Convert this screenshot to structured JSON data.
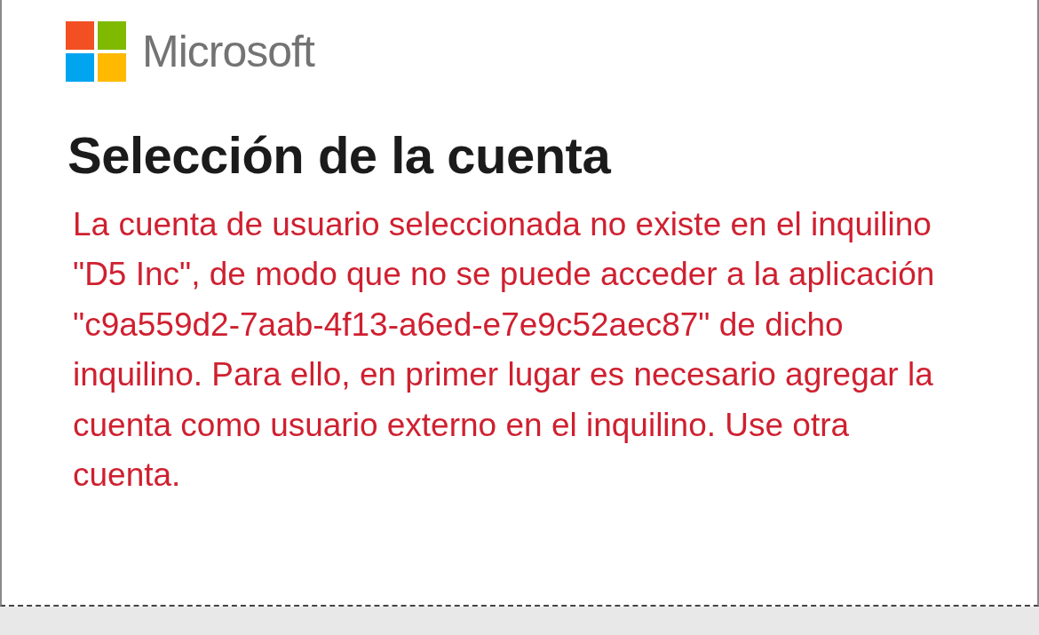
{
  "brand": {
    "name": "Microsoft"
  },
  "title": "Selección de la cuenta",
  "error_message": "La cuenta de usuario seleccionada no existe en el inquilino \"D5 Inc\", de modo que no se puede acceder a la aplicación \"c9a559d2-7aab-4f13-a6ed-e7e9c52aec87\" de dicho inquilino. Para ello, en primer lugar es necesario agregar la cuenta como usuario externo en el inquilino. Use otra cuenta."
}
